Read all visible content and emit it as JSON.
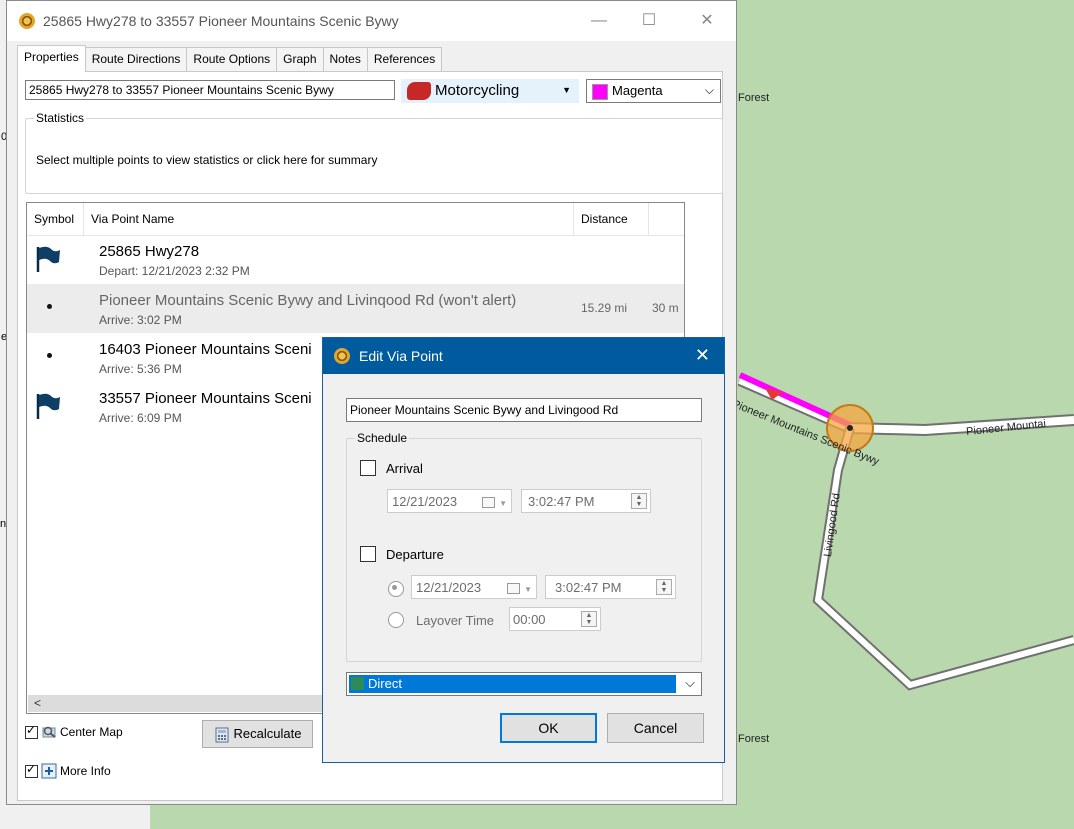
{
  "window": {
    "title": "25865 Hwy278 to 33557 Pioneer Mountains Scenic Bywy",
    "minimize": "—",
    "maximize": "☐",
    "close": "✕"
  },
  "tabs": [
    "Properties",
    "Route Directions",
    "Route Options",
    "Graph",
    "Notes",
    "References"
  ],
  "route": {
    "name": "25865 Hwy278 to 33557 Pioneer Mountains Scenic Bywy",
    "mode": "Motorcycling",
    "color_name": "Magenta",
    "color_hex": "#ff00ff"
  },
  "statistics": {
    "legend": "Statistics",
    "text": "Select multiple points to view statistics or click here for summary"
  },
  "columns": [
    "Symbol",
    "Via Point Name",
    "Distance"
  ],
  "rows": [
    {
      "symbol": "flag-icon",
      "name": "25865 Hwy278",
      "sub": "Depart: 12/21/2023 2:32 PM",
      "distance": "",
      "time": ""
    },
    {
      "symbol": "dot-icon",
      "name": "Pioneer Mountains Scenic Bywy and Livinqood Rd (won't alert)",
      "sub": "Arrive: 3:02 PM",
      "distance": "15.29 mi",
      "time": "30 m"
    },
    {
      "symbol": "dot-icon",
      "name": "16403 Pioneer Mountains Sceni",
      "sub": "Arrive: 5:36 PM",
      "distance": "",
      "time": ""
    },
    {
      "symbol": "flag-icon",
      "name": "33557 Pioneer Mountains Sceni",
      "sub": "Arrive: 6:09 PM",
      "distance": "",
      "time": ""
    }
  ],
  "bottom": {
    "center_map": "Center Map",
    "more_info": "More Info",
    "recalculate": "Recalculate"
  },
  "left_fragments": [
    "0",
    "e",
    "ns"
  ],
  "map": {
    "labels": {
      "forest_top": "Forest",
      "forest_bottom": "Forest",
      "road_main": "Pioneer Mountains Scenic Bywy",
      "road_right": "Pioneer Mountai",
      "road_side": "Livingood Rd"
    }
  },
  "dialog": {
    "title": "Edit Via Point",
    "close": "✕",
    "name_value": "Pioneer Mountains Scenic Bywy and Livingood Rd",
    "schedule_legend": "Schedule",
    "arrival_label": "Arrival",
    "arrival_date": "12/21/2023",
    "arrival_time": "3:02:47 PM",
    "departure_label": "Departure",
    "departure_date": "12/21/2023",
    "departure_time": "3:02:47 PM",
    "layover_label": "Layover Time",
    "layover_value": "00:00",
    "routing_mode": "Direct",
    "ok": "OK",
    "cancel": "Cancel"
  }
}
